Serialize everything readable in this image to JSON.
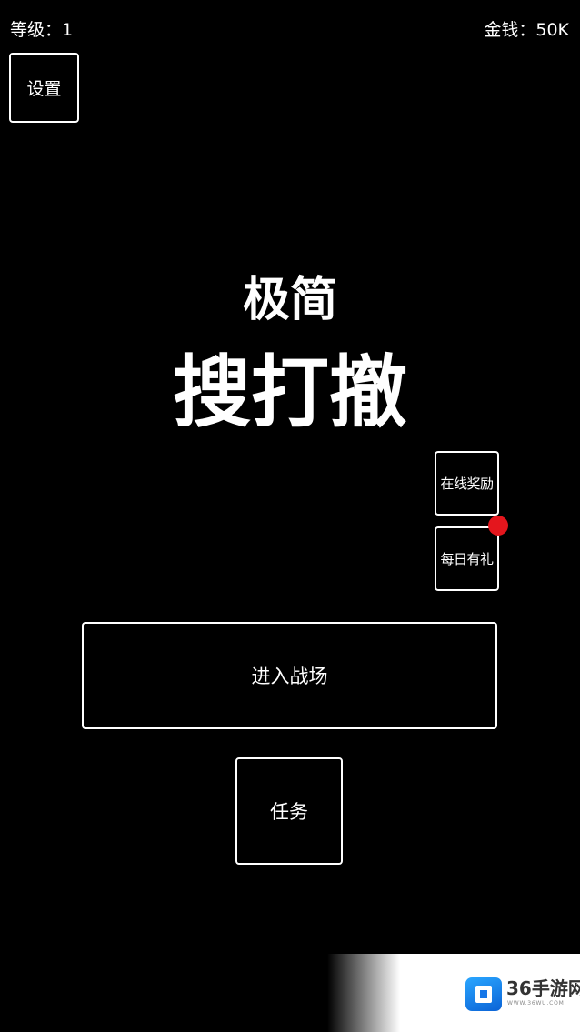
{
  "status": {
    "level_text": "等级：1",
    "money_text": "金钱：50K"
  },
  "buttons": {
    "settings": "设置",
    "online_reward": "在线奖励",
    "daily_gift": "每日有礼",
    "enter_battle": "进入战场",
    "tasks": "任务"
  },
  "title": {
    "line1": "极简",
    "line2": "搜打撤"
  },
  "watermark": {
    "brand": "36手游网",
    "url": "WWW.36WU.COM"
  },
  "colors": {
    "background": "#000000",
    "foreground": "#ffffff",
    "notification_dot": "#e4161d"
  }
}
